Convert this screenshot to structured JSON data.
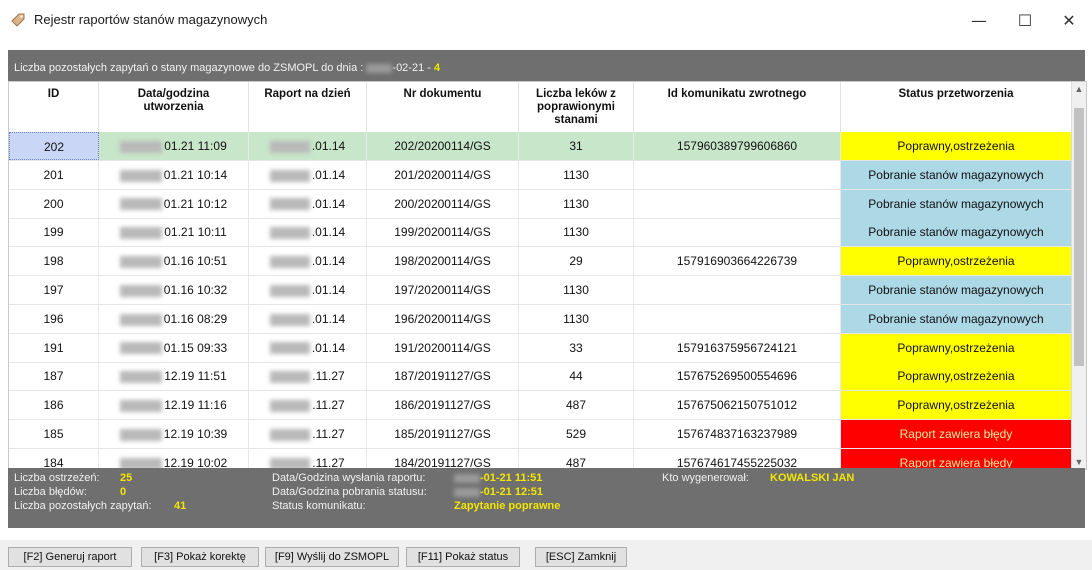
{
  "window": {
    "title": "Rejestr raportów stanów magazynowych",
    "minimize": "—",
    "maximize": "☐",
    "close": "✕"
  },
  "infobar": {
    "text_before": "Liczba pozostałych zapytań o stany magazynowe do ZSMOPL do dnia : ",
    "date_suffix": "-02-21",
    "sep": " - ",
    "count": "4"
  },
  "table": {
    "columns": [
      "ID",
      "Data/godzina utworzenia",
      "Raport na dzień",
      "Nr dokumentu",
      "Liczba leków z poprawionymi stanami",
      "Id komunikatu zwrotnego",
      "Status przetworzenia"
    ],
    "rows": [
      {
        "id": "202",
        "created": "01.21 11:09",
        "report_day": ".01.14",
        "doc": "202/20200114/GS",
        "count": "31",
        "msg_id": "157960389799606860",
        "status": "Poprawny,ostrzeżenia",
        "status_type": "ok"
      },
      {
        "id": "201",
        "created": "01.21 10:14",
        "report_day": ".01.14",
        "doc": "201/20200114/GS",
        "count": "1130",
        "msg_id": "",
        "status": "Pobranie stanów magazynowych",
        "status_type": "dl"
      },
      {
        "id": "200",
        "created": "01.21 10:12",
        "report_day": ".01.14",
        "doc": "200/20200114/GS",
        "count": "1130",
        "msg_id": "",
        "status": "Pobranie stanów magazynowych",
        "status_type": "dl"
      },
      {
        "id": "199",
        "created": "01.21 10:11",
        "report_day": ".01.14",
        "doc": "199/20200114/GS",
        "count": "1130",
        "msg_id": "",
        "status": "Pobranie stanów magazynowych",
        "status_type": "dl"
      },
      {
        "id": "198",
        "created": "01.16 10:51",
        "report_day": ".01.14",
        "doc": "198/20200114/GS",
        "count": "29",
        "msg_id": "157916903664226739",
        "status": "Poprawny,ostrzeżenia",
        "status_type": "ok"
      },
      {
        "id": "197",
        "created": "01.16 10:32",
        "report_day": ".01.14",
        "doc": "197/20200114/GS",
        "count": "1130",
        "msg_id": "",
        "status": "Pobranie stanów magazynowych",
        "status_type": "dl"
      },
      {
        "id": "196",
        "created": "01.16 08:29",
        "report_day": ".01.14",
        "doc": "196/20200114/GS",
        "count": "1130",
        "msg_id": "",
        "status": "Pobranie stanów magazynowych",
        "status_type": "dl"
      },
      {
        "id": "191",
        "created": "01.15 09:33",
        "report_day": ".01.14",
        "doc": "191/20200114/GS",
        "count": "33",
        "msg_id": "157916375956724121",
        "status": "Poprawny,ostrzeżenia",
        "status_type": "ok"
      },
      {
        "id": "187",
        "created": "12.19 11:51",
        "report_day": ".11.27",
        "doc": "187/20191127/GS",
        "count": "44",
        "msg_id": "157675269500554696",
        "status": "Poprawny,ostrzeżenia",
        "status_type": "ok"
      },
      {
        "id": "186",
        "created": "12.19 11:16",
        "report_day": ".11.27",
        "doc": "186/20191127/GS",
        "count": "487",
        "msg_id": "157675062150751012",
        "status": "Poprawny,ostrzeżenia",
        "status_type": "ok"
      },
      {
        "id": "185",
        "created": "12.19 10:39",
        "report_day": ".11.27",
        "doc": "185/20191127/GS",
        "count": "529",
        "msg_id": "157674837163237989",
        "status": "Raport zawiera błędy",
        "status_type": "err"
      },
      {
        "id": "184",
        "created": "12.19 10:02",
        "report_day": ".11.27",
        "doc": "184/20191127/GS",
        "count": "487",
        "msg_id": "157674617455225032",
        "status": "Raport zawiera błędy",
        "status_type": "err"
      }
    ]
  },
  "footer": {
    "warnings_label": "Liczba ostrzeżeń:",
    "warnings_value": "25",
    "errors_label": "Liczba błędów:",
    "errors_value": "0",
    "remaining_label": "Liczba pozostałych zapytań:",
    "remaining_value": "41",
    "sent_label": "Data/Godzina wysłania raportu:",
    "sent_value": "-01-21 11:51",
    "fetched_label": "Data/Godzina pobrania statusu:",
    "fetched_value": "-01-21 12:51",
    "msg_status_label": "Status komunikatu:",
    "msg_status_value": "Zapytanie poprawne",
    "generated_by_label": "Kto wygenerował:",
    "generated_by_value": "KOWALSKI JAN"
  },
  "buttons": {
    "generate": "[F2] Generuj raport",
    "correction": "[F3] Pokaż korektę",
    "send": "[F9] Wyślij do ZSMOPL",
    "status": "[F11] Pokaż status",
    "close": "[ESC] Zamknij"
  },
  "colors": {
    "status_ok": "#ffff00",
    "status_download": "#add8e6",
    "status_error": "#ff0000",
    "selected_row": "#c8e6c9",
    "panel_gray": "#6f6f6f",
    "highlight_yellow": "#f3e600"
  }
}
